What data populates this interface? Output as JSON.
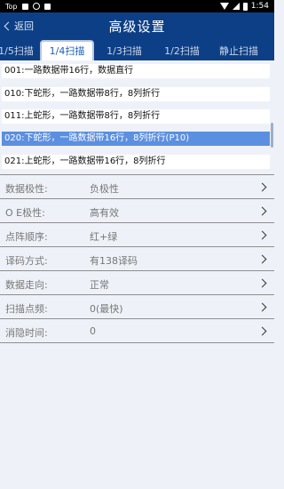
{
  "status_bar": {
    "carrier": "Top",
    "time": "1:54"
  },
  "header": {
    "back_label": "返回",
    "title": "高级设置"
  },
  "tabs": [
    {
      "label": "1/5扫描",
      "active": false
    },
    {
      "label": "1/4扫描",
      "active": true
    },
    {
      "label": "1/3扫描",
      "active": false
    },
    {
      "label": "1/2扫描",
      "active": false
    },
    {
      "label": "静止扫描",
      "active": false
    }
  ],
  "scan_options": [
    {
      "text": "001:一路数据带16行，数据直行",
      "selected": false
    },
    {
      "text": "010:下蛇形，一路数据带8行，8列折行",
      "selected": false
    },
    {
      "text": "011:上蛇形，一路数据带8行，8列折行",
      "selected": false
    },
    {
      "text": "020:下蛇形，一路数据带16行，8列折行(P10)",
      "selected": true
    },
    {
      "text": "021:上蛇形，一路数据带16行，8列折行",
      "selected": false
    }
  ],
  "settings": [
    {
      "label": "数据极性:",
      "value": "负极性"
    },
    {
      "label": "O E极性:",
      "value": "高有效"
    },
    {
      "label": "点阵顺序:",
      "value": "红+绿"
    },
    {
      "label": "译码方式:",
      "value": "有138译码"
    },
    {
      "label": "数据走向:",
      "value": "正常"
    },
    {
      "label": "扫描点频:",
      "value": "0(最快)"
    },
    {
      "label": "消隐时间:",
      "value": "0"
    }
  ],
  "colors": {
    "header_bg": "#0d3f86",
    "selected_bg": "#5b8fe0",
    "page_bg": "#eef2f8"
  }
}
